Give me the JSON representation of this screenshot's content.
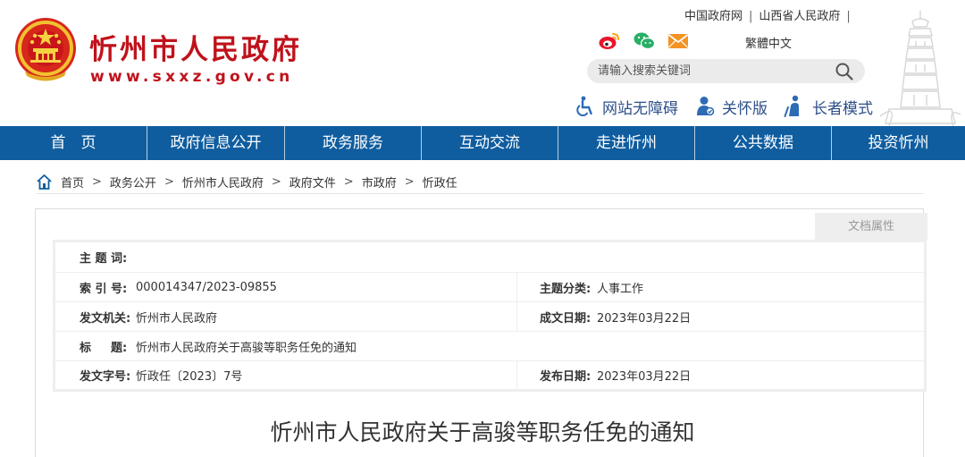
{
  "header": {
    "site_title": "忻州市人民政府",
    "site_url": "www.sxxz.gov.cn",
    "top_links": [
      "中国政府网",
      "山西省人民政府"
    ],
    "lang_switch": "繁體中文",
    "search_placeholder": "请输入搜索关键词",
    "accessibility": {
      "barrier_free": "网站无障碍",
      "care_mode": "关怀版",
      "elder_mode": "长者模式"
    },
    "icons": [
      "weibo-icon",
      "wechat-icon",
      "mail-icon",
      "search-icon",
      "wheelchair-icon",
      "care-icon",
      "elder-icon"
    ],
    "brand_color": "#c0121b"
  },
  "nav": {
    "color": "#0f5d9f",
    "items": [
      "首　页",
      "政府信息公开",
      "政务服务",
      "互动交流",
      "走进忻州",
      "公共数据",
      "投资忻州"
    ]
  },
  "breadcrumb": [
    "首页",
    "政务公开",
    "忻州市人民政府",
    "政府文件",
    "市政府",
    "忻政任"
  ],
  "doc_attrs": {
    "tab_label": "文档属性",
    "subject_words_label": "主 题 词:",
    "subject_words_value": "",
    "index_label": "索 引 号:",
    "index_value": "000014347/2023-09855",
    "category_label": "主题分类:",
    "category_value": "人事工作",
    "issuer_label": "发文机关:",
    "issuer_value": "忻州市人民政府",
    "written_date_label": "成文日期:",
    "written_date_value": "2023年03月22日",
    "title_label_a": "标",
    "title_label_b": "题:",
    "title_value": "忻州市人民政府关于高骏等职务任免的通知",
    "doc_no_label": "发文字号:",
    "doc_no_value": "忻政任〔2023〕7号",
    "publish_date_label": "发布日期:",
    "publish_date_value": "2023年03月22日"
  },
  "document_title": "忻州市人民政府关于高骏等职务任免的通知"
}
